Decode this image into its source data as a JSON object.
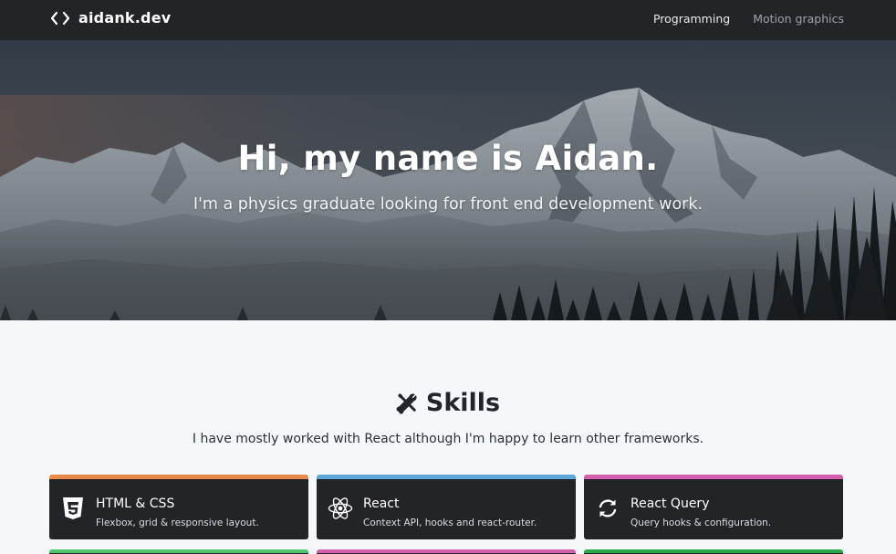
{
  "nav": {
    "brand": "aidank.dev",
    "links": [
      {
        "label": "Programming",
        "active": true
      },
      {
        "label": "Motion graphics",
        "active": false
      }
    ]
  },
  "hero": {
    "title": "Hi, my name is Aidan.",
    "subtitle": "I'm a physics graduate looking for front end development work."
  },
  "skills": {
    "title": "Skills",
    "description": "I have mostly worked with React although I'm happy to learn other frameworks.",
    "cards": [
      {
        "title": "HTML & CSS",
        "desc": "Flexbox, grid & responsive layout.",
        "accent": "#e8894a",
        "icon": "css3-icon"
      },
      {
        "title": "React",
        "desc": "Context API, hooks and react-router.",
        "accent": "#5ea8d9",
        "icon": "react-icon"
      },
      {
        "title": "React Query",
        "desc": "Query hooks & configuration.",
        "accent": "#d45fae",
        "icon": "refresh-icon"
      }
    ],
    "next_row_accents": [
      "#4fc46b",
      "#d45fae",
      "#2aa84a"
    ]
  },
  "colors": {
    "navbar": "#232427",
    "page_bg": "#f4f8fb",
    "card_bg": "#232427"
  }
}
